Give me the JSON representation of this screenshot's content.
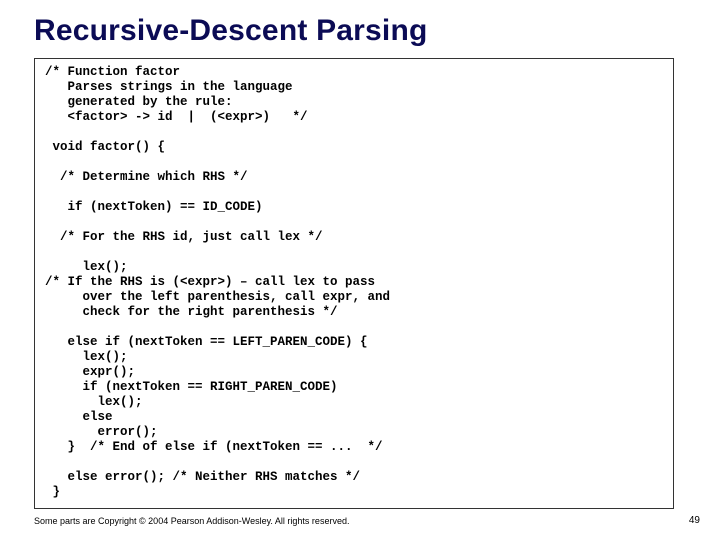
{
  "title": "Recursive-Descent Parsing",
  "code": "/* Function factor\n   Parses strings in the language\n   generated by the rule:\n   <factor> -> id  |  (<expr>)   */\n\n void factor() {\n\n  /* Determine which RHS */\n\n   if (nextToken) == ID_CODE)\n\n  /* For the RHS id, just call lex */\n\n     lex();\n/* If the RHS is (<expr>) – call lex to pass\n     over the left parenthesis, call expr, and\n     check for the right parenthesis */\n\n   else if (nextToken == LEFT_PAREN_CODE) {\n     lex();\n     expr();\n     if (nextToken == RIGHT_PAREN_CODE)\n       lex();\n     else\n       error();\n   }  /* End of else if (nextToken == ...  */\n\n   else error(); /* Neither RHS matches */\n }",
  "footer": "Some parts are Copyright © 2004 Pearson Addison-Wesley. All rights reserved.",
  "page": "49"
}
